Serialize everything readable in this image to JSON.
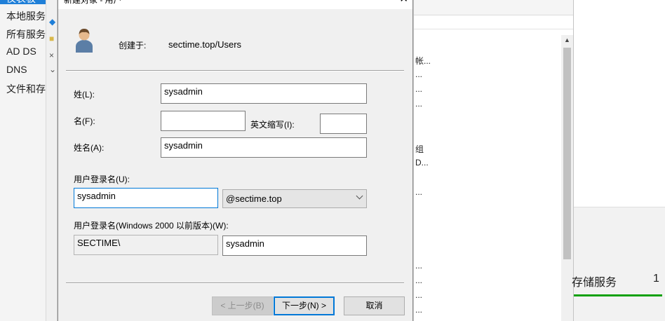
{
  "nav": {
    "items": [
      {
        "label": "仪表板",
        "active": true
      },
      {
        "label": "本地服务器",
        "active": false
      },
      {
        "label": "所有服务器",
        "active": false
      },
      {
        "label": "AD DS",
        "active": false
      },
      {
        "label": "DNS",
        "active": false
      },
      {
        "label": "文件和存",
        "active": false
      }
    ]
  },
  "bg_list": {
    "rows": [
      "帐...",
      "...",
      "...",
      "...",
      "",
      "组",
      "D...",
      "",
      "...",
      "",
      "",
      "",
      "",
      "",
      "...",
      "...",
      "...",
      "...",
      ".."
    ]
  },
  "tile": {
    "title": "存储服务",
    "count": "1"
  },
  "dialog": {
    "title": "新建对象 - 用户",
    "close": "✕",
    "created_in_label": "创建于:",
    "created_in_value": "sectime.top/Users",
    "last_name_label": "姓(L):",
    "last_name_value": "sysadmin",
    "first_name_label": "名(F):",
    "first_name_value": "",
    "initials_label": "英文缩写(I):",
    "initials_value": "",
    "full_name_label": "姓名(A):",
    "full_name_value": "sysadmin",
    "logon_label": "用户登录名(U):",
    "logon_value": "sysadmin",
    "domain_value": "@sectime.top",
    "pre2000_label": "用户登录名(Windows 2000 以前版本)(W):",
    "pre2000_domain": "SECTIME\\",
    "pre2000_value": "sysadmin",
    "back_button": "< 上一步(B)",
    "next_button": "下一步(N) >",
    "cancel_button": "取消"
  },
  "colors": {
    "accent": "#0078d7",
    "nav_active": "#1f7fd8",
    "tile_bar": "#13a10e"
  }
}
